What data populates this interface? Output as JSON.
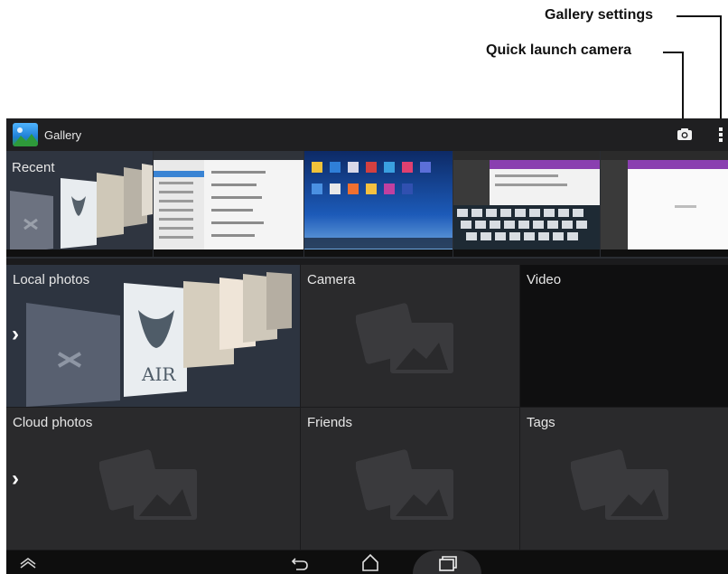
{
  "callouts": {
    "gallery_settings": "Gallery settings",
    "quick_launch_camera": "Quick launch camera"
  },
  "actionbar": {
    "app_title": "Gallery",
    "icons": [
      "gallery-app-icon",
      "camera-icon",
      "overflow-menu-icon"
    ]
  },
  "recent": {
    "label": "Recent",
    "thumbnail_count": 5
  },
  "albums": [
    {
      "label": "Local photos",
      "has_chevron": true
    },
    {
      "label": "Camera",
      "has_chevron": false
    },
    {
      "label": "Video",
      "has_chevron": false
    },
    {
      "label": "Cloud photos",
      "has_chevron": true
    },
    {
      "label": "Friends",
      "has_chevron": false
    },
    {
      "label": "Tags",
      "has_chevron": false
    }
  ],
  "system_nav": {
    "icons": [
      "navbar-up-icon",
      "back-icon",
      "home-icon",
      "recent-apps-icon"
    ]
  },
  "colors": {
    "screen_bg": "#1b1b1d",
    "tile_bg": "#2a2a2c",
    "accent_purple": "#8a3fb0"
  }
}
